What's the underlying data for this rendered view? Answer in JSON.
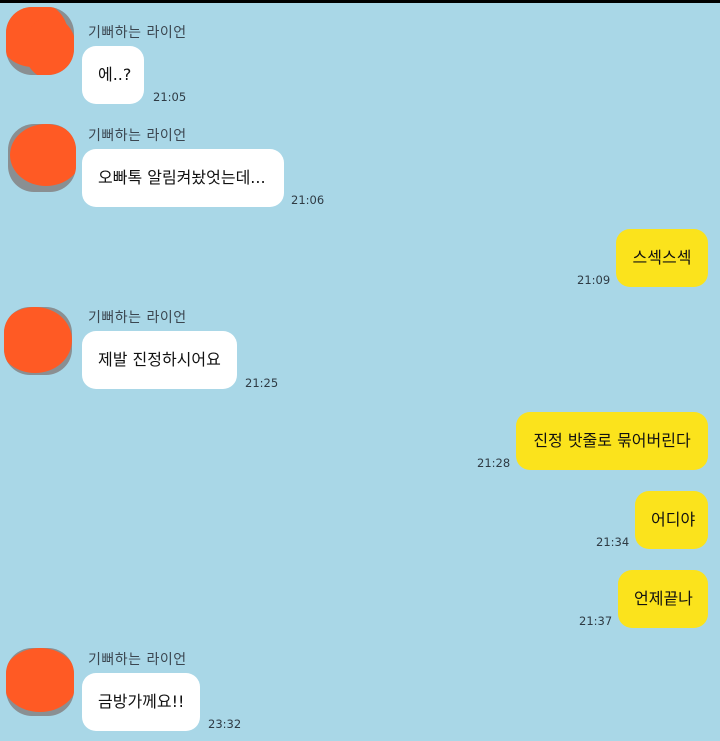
{
  "messages": [
    {
      "sender": "기뻐하는 라이언",
      "text": "에..?",
      "time": "21:05"
    },
    {
      "sender": "기뻐하는 라이언",
      "text": "오빠톡 알림켜놨엇는데...",
      "time": "21:06"
    },
    {
      "text": "스섹스섹",
      "time": "21:09"
    },
    {
      "sender": "기뻐하는 라이언",
      "text": "제발 진정하시어요",
      "time": "21:25"
    },
    {
      "text": "진정 밧줄로 묶어버린다",
      "time": "21:28"
    },
    {
      "text": "어디야",
      "time": "21:34"
    },
    {
      "text": "언제끝나",
      "time": "21:37"
    },
    {
      "sender": "기뻐하는 라이언",
      "text": "금방가께요!!",
      "time": "23:32"
    }
  ],
  "colors": {
    "background": "#a9d7e7",
    "incoming_bubble": "#ffffff",
    "outgoing_bubble": "#fbe31c",
    "avatar_cover": "#ff5a24"
  },
  "icons": {
    "avatar": "profile-avatar-redacted"
  }
}
